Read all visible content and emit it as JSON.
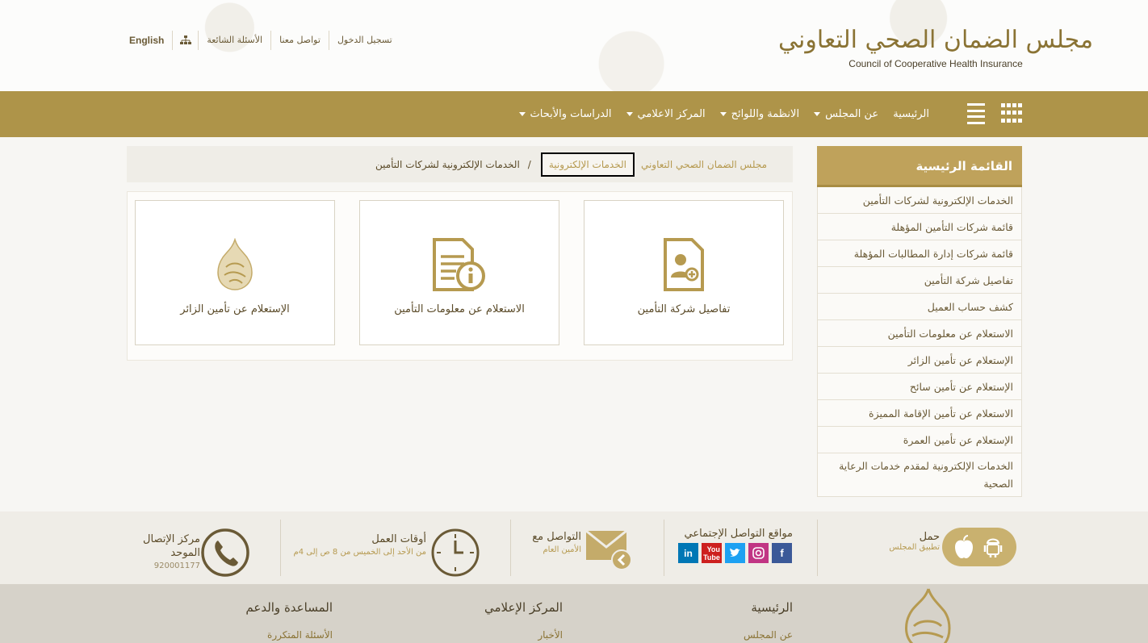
{
  "header": {
    "logo_ar": "مجلس الضمان الصحي التعاوني",
    "logo_en": "Council of Cooperative Health Insurance",
    "links": {
      "login": "تسجيل الدخول",
      "contact": "تواصل معنا",
      "faq": "الأسئلة الشائعة",
      "english": "English"
    }
  },
  "nav": {
    "items": [
      {
        "label": "الرئيسية",
        "dropdown": false
      },
      {
        "label": "عن المجلس",
        "dropdown": true
      },
      {
        "label": "الانظمة واللوائح",
        "dropdown": true
      },
      {
        "label": "المركز الاعلامي",
        "dropdown": true
      },
      {
        "label": "الدراسات والأبحاث",
        "dropdown": true
      }
    ]
  },
  "sidebar": {
    "title": "القائمة الرئيسية",
    "items": [
      "الخدمات الإلكترونية لشركات التأمين",
      "قائمة شركات التأمين المؤهلة",
      "قائمة شركات إدارة المطالبات المؤهلة",
      "تفاصيل شركة التأمين",
      "كشف حساب العميل",
      "الاستعلام عن معلومات التأمين",
      "الإستعلام عن تأمين الزائر",
      "الإستعلام عن تأمين سائح",
      "الاستعلام عن تأمين الإقامة المميزة",
      "الإستعلام عن تأمين العمرة",
      "الخدمات الإلكترونية لمقدم خدمات الرعاية الصحية"
    ]
  },
  "breadcrumb": {
    "home": "مجلس الضمان الصحي التعاوني",
    "section": "الخدمات الإلكترونية",
    "separator": "/",
    "current": "الخدمات الإلكترونية لشركات التأمين"
  },
  "cards": [
    {
      "label": "تفاصيل شركة التأمين",
      "icon": "user-document-icon"
    },
    {
      "label": "الاستعلام عن معلومات التأمين",
      "icon": "document-info-icon"
    },
    {
      "label": "الإستعلام عن تأمين الزائر",
      "icon": "council-emblem-icon"
    }
  ],
  "info": {
    "app": {
      "title": "حمل",
      "subtitle": "تطبيق المجلس"
    },
    "social": {
      "title": "مواقع التواصل الإجتماعي"
    },
    "contact": {
      "title": "التواصل مع",
      "subtitle": "الأمين العام"
    },
    "hours": {
      "title": "أوقات العمل",
      "subtitle": "من الأحد إلى الخميس من 8 ص إلى 4م"
    },
    "callcenter": {
      "title1": "مركز الإتصال",
      "title2": "الموحد",
      "number": "920001177"
    }
  },
  "footer": {
    "col1": {
      "title": "الرئيسية",
      "first_link": "عن المجلس"
    },
    "col2": {
      "title": "المركز الإعلامي",
      "first_link": "الأخبار"
    },
    "col3": {
      "title": "المساعدة والدعم",
      "first_link": "الأسئلة المتكررة"
    }
  },
  "colors": {
    "brand_gold": "#ae9449",
    "gold_light": "#bfa25b",
    "text_dark": "#5a4a28"
  }
}
